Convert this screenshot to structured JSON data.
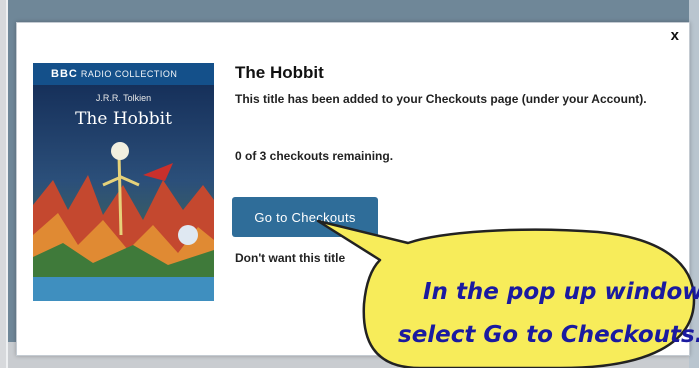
{
  "dialog": {
    "close_label": "x",
    "cover": {
      "brand": "BBC",
      "collection": "RADIO COLLECTION",
      "author": "J.R.R. Tolkien",
      "title": "The Hobbit"
    },
    "book_title": "The Hobbit",
    "added_message": "This title has been added to your Checkouts page (under your Account).",
    "remaining": "0 of 3 checkouts remaining.",
    "go_button_label": "Go to Checkouts",
    "dont_want_text": "Don't want this title"
  },
  "callout": {
    "line1": "In the pop up window,",
    "line2": "select Go to Checkouts.",
    "fill_color": "#f7ec5a",
    "text_color": "#1a1aa0"
  },
  "colors": {
    "button": "#2f6d99",
    "backdrop": "#6f8798"
  }
}
